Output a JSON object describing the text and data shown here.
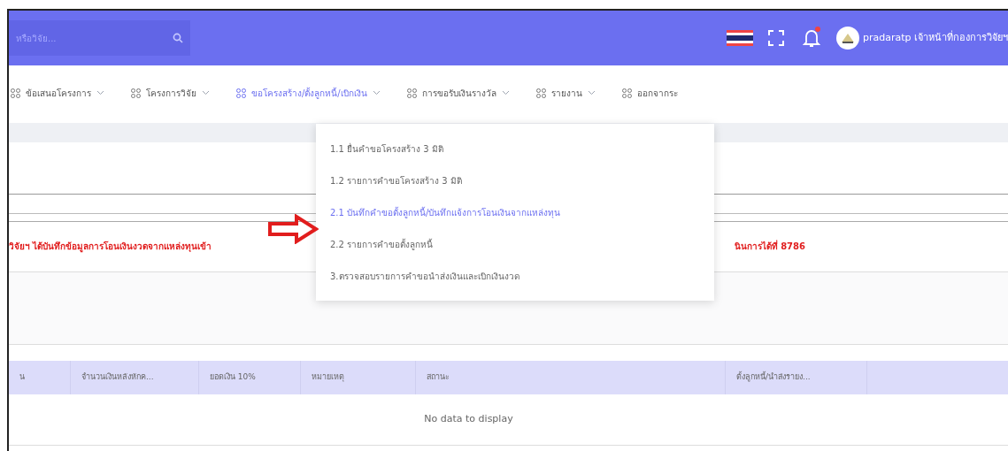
{
  "header": {
    "search": {
      "placeholder": "หรือวิจัย..."
    },
    "user": "pradaratp เจ้าหน้าที่กองการวิจัยฯ",
    "notification": {
      "unread": true
    }
  },
  "nav": [
    {
      "label": "ข้อเสนอโครงการ",
      "selected": false
    },
    {
      "label": "โครงการวิจัย",
      "selected": false
    },
    {
      "label": "ขอโครงสร้าง/ตั้งลูกหนี้/เบิกเงิน",
      "selected": true
    },
    {
      "label": "การขอรับเงินรางวัล",
      "selected": false
    },
    {
      "label": "รายงาน",
      "selected": false
    },
    {
      "label": "ออกจากระ",
      "selected": false
    }
  ],
  "menu": [
    {
      "label": "1.1 ยื่นคำขอโครงสร้าง 3 มิติ",
      "selected": false
    },
    {
      "label": "1.2 รายการคำขอโครงสร้าง 3 มิติ",
      "selected": false
    },
    {
      "label": "2.1 บันทึกคำขอตั้งลูกหนี้/บันทึกแจ้งการโอนเงินจากแหล่งทุน",
      "selected": true
    },
    {
      "label": "2.2 รายการคำขอตั้งลูกหนี้",
      "selected": false
    },
    {
      "label": "3.ตรวจสอบรายการคำขอนำส่งเงินและเบิกเงินงวด",
      "selected": false
    }
  ],
  "notice": {
    "left": "วิจัยฯ ได้บันทึกข้อมูลการโอนเงินงวดจากแหล่งทุนเข้า",
    "right": "นินการได้ที่ 8786"
  },
  "table": {
    "columns": [
      "น",
      "จำนวนเงินหลังหักค...",
      "ยอดเงิน 10%",
      "หมายเหตุ",
      "สถานะ",
      "ตั้งลูกหนี้/นำส่งรายง..."
    ],
    "empty": "No data to display"
  }
}
